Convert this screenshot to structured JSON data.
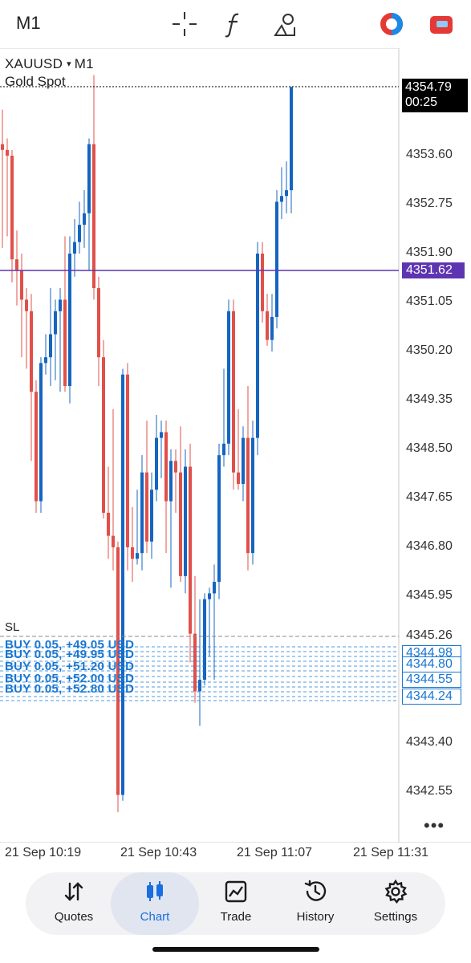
{
  "toolbar": {
    "timeframe": "M1",
    "icons": [
      "crosshair-icon",
      "indicator-f-icon",
      "objects-icon",
      "signal-toggle-icon",
      "account-switch-icon"
    ]
  },
  "symbol": {
    "name": "XAUUSD",
    "dropdown_glyph": "▾",
    "timeframe": "M1",
    "description": "Gold Spot"
  },
  "price_axis": {
    "labels": [
      "4353.60",
      "4352.75",
      "4351.90",
      "4351.05",
      "4350.20",
      "4349.35",
      "4348.50",
      "4347.65",
      "4346.80",
      "4345.95",
      "4345.26",
      "4343.40",
      "4342.55"
    ]
  },
  "price_tags": {
    "ask": "4354.79",
    "countdown": "00:25",
    "bid": "4351.62",
    "orders": [
      "4344.98",
      "4344.80",
      "4344.55",
      "4344.24"
    ]
  },
  "stop_loss_label": "SL",
  "trade_labels": [
    "BUY 0.05, +49.05 USD",
    "BUY 0.05, +49.95 USD",
    "BUY 0.05, +51.20 USD",
    "BUY 0.05, +52.00 USD",
    "BUY 0.05, +52.80 USD"
  ],
  "time_axis": [
    "21 Sep 10:19",
    "21 Sep 10:43",
    "21 Sep 11:07",
    "21 Sep 11:31"
  ],
  "more_glyph": "•••",
  "nav": [
    {
      "label": "Quotes",
      "icon": "quotes-arrows-icon"
    },
    {
      "label": "Chart",
      "icon": "candles-icon",
      "active": true
    },
    {
      "label": "Trade",
      "icon": "trade-chart-icon"
    },
    {
      "label": "History",
      "icon": "history-clock-icon"
    },
    {
      "label": "Settings",
      "icon": "gear-icon"
    }
  ],
  "colors": {
    "bull": "#1565c0",
    "bear": "#e0504a",
    "bid_line": "#5e35b1",
    "order_line": "#1976d2",
    "active_nav": "#1a6fe0"
  }
}
